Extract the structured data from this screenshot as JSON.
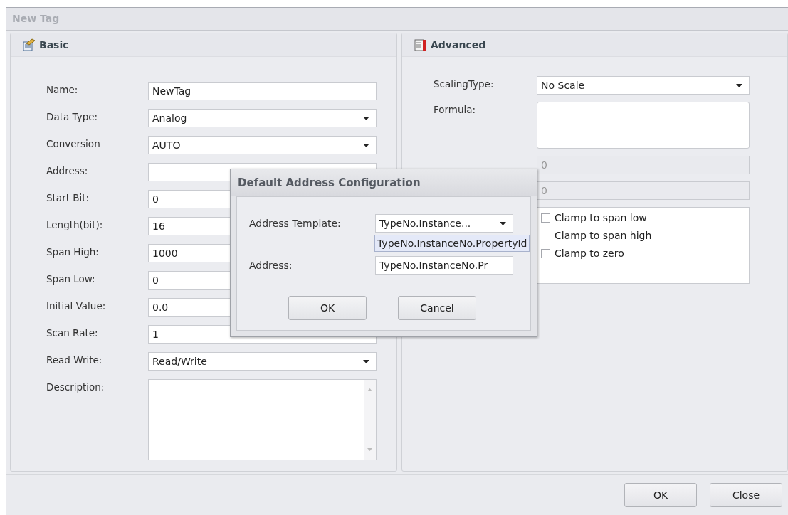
{
  "window": {
    "title": "New Tag"
  },
  "basic": {
    "title": "Basic",
    "fields": [
      {
        "kind": "text",
        "label": "Name:",
        "value": "NewTag"
      },
      {
        "kind": "select",
        "label": "Data Type:",
        "value": "Analog"
      },
      {
        "kind": "select",
        "label": "Conversion",
        "value": "AUTO"
      },
      {
        "kind": "text",
        "label": "Address:"
      },
      {
        "kind": "text",
        "label": "Start Bit:",
        "value": "0"
      },
      {
        "kind": "text",
        "label": "Length(bit):",
        "value": "16"
      },
      {
        "kind": "text",
        "label": "Span High:",
        "value": "1000"
      },
      {
        "kind": "text",
        "label": "Span Low:",
        "value": "0"
      },
      {
        "kind": "text",
        "label": "Initial Value:",
        "value": "0.0"
      },
      {
        "kind": "text",
        "label": "Scan Rate:",
        "value": "1"
      },
      {
        "kind": "select",
        "label": "Read Write:",
        "value": "Read/Write"
      },
      {
        "kind": "textarea",
        "label": "Description:"
      }
    ]
  },
  "advanced": {
    "title": "Advanced",
    "fields": [
      {
        "kind": "select",
        "label": "ScalingType:",
        "value": "No Scale"
      },
      {
        "kind": "formula",
        "label": "Formula:"
      },
      {
        "kind": "disabled",
        "value": "0"
      },
      {
        "kind": "disabled",
        "value": "0"
      }
    ],
    "options": [
      {
        "label": "Clamp to span low",
        "checked": false
      },
      {
        "label": "Clamp to span high"
      },
      {
        "label": "Clamp to zero",
        "checked": false
      }
    ]
  },
  "buttons": [
    "OK",
    "Close"
  ],
  "dialog": {
    "title": "Default Address Configuration",
    "template_label": "Address Template:",
    "template_value": "TypeNo.Instance...",
    "popup_option": "TypeNo.InstanceNo.PropertyId",
    "address_label": "Address:",
    "address_value": "TypeNo.InstanceNo.Pr",
    "buttons": [
      "OK",
      "Cancel"
    ]
  }
}
